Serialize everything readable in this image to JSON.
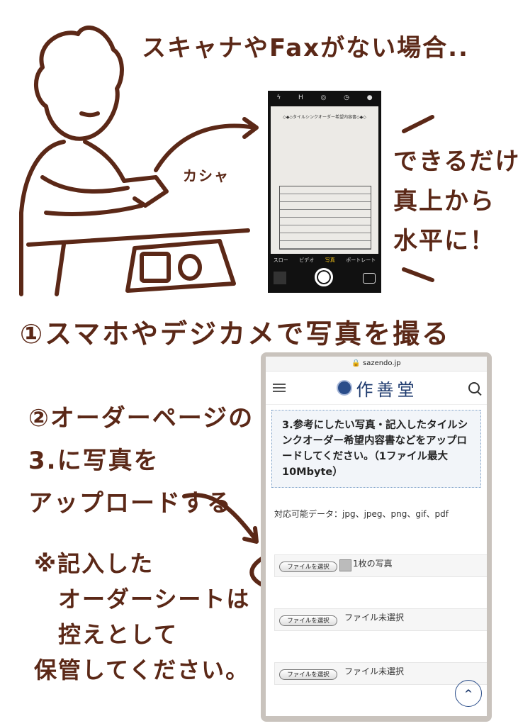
{
  "heading": "スキャナやFaxがない場合..",
  "step1": "①スマホやデジカメで写真を撮る",
  "step2": "②オーダーページの\n3.に写真を\nアップロードする",
  "note": "※記入した\n　オーダーシートは\n　控えとして\n保管してください。",
  "tip": "できるだけ\n真上から\n水平に！",
  "sound_effect": "カシャ",
  "ink_color": "#5b2817",
  "camera": {
    "sheet_title": "◇◆◇タイルシンクオーダー希望内容書◇◆◇",
    "modes": [
      "スロー",
      "ビデオ",
      "写真",
      "ポートレート"
    ],
    "active_mode": "写真"
  },
  "phone": {
    "url": "sazendo.jp",
    "brand": "作善堂",
    "brand_color": "#1e3a6e",
    "section_text": "3.参考にしたい写真・記入したタイルシンクオーダー希望内容書などをアップロードしてください。（1ファイル最大10Mbyte）",
    "formats": "対応可能データ：jpg、jpeg、png、gif、pdf",
    "file_inputs": [
      {
        "button": "ファイルを選択",
        "status": "1枚の写真"
      },
      {
        "button": "ファイルを選択",
        "status": "ファイル未選択"
      },
      {
        "button": "ファイルを選択",
        "status": "ファイル未選択"
      }
    ],
    "scroll_top_icon": "chevron-up-icon"
  }
}
